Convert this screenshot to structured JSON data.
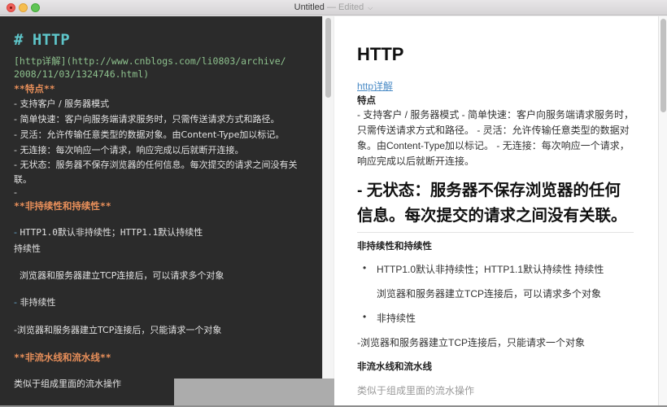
{
  "window": {
    "title": "Untitled",
    "status": "— Edited",
    "title_menu_icon": "chevron-down-icon"
  },
  "traffic_lights": {
    "close": "close-button",
    "minimize": "minimize-button",
    "zoom": "zoom-button"
  },
  "colors": {
    "editor_bg": "#2b2b2b",
    "heading": "#5ec5c9",
    "link": "#8dc08d",
    "bold": "#e88f5a",
    "list_marker": "#6aaed6",
    "preview_link": "#4a8bc6"
  },
  "editor": {
    "lines": [
      "# HTTP",
      "[http详解](http://www.cnblogs.com/li0803/archive/",
      "2008/11/03/1324746.html)",
      "**特点**",
      "- 支持客户 / 服务器模式",
      "- 简单快速：客户向服务端请求服务时，只需传送请求方式和路径。",
      "- 灵活：允许传输任意类型的数据对象。由Content-Type加以标记。",
      "- 无连接：每次响应一个请求，响应完成以后就断开连接。",
      "- 无状态：服务器不保存浏览器的任何信息。每次提交的请求之间没有关",
      "联。",
      "-",
      "**非持续性和持续性**",
      "- HTTP1.0默认非持续性；HTTP1.1默认持续性",
      "持续性",
      "浏览器和服务器建立TCP连接后，可以请求多个对象",
      "- 非持续性",
      "-浏览器和服务器建立TCP连接后，只能请求一个对象",
      "**非流水线和流水线**",
      "类似于组成里面的流水操作"
    ]
  },
  "preview": {
    "h1": "HTTP",
    "link": "http详解",
    "features_heading": "特点",
    "features_paragraph": "- 支持客户 / 服务器模式 - 简单快速：客户向服务端请求服务时，只需传送请求方式和路径。 - 灵活：允许传输任意类型的数据对象。由Content-Type加以标记。 - 无连接：每次响应一个请求，响应完成以后就断开连接。",
    "h2": "- 无状态：服务器不保存浏览器的任何信息。每次提交的请求之间没有关联。",
    "persistence_heading": "非持续性和持续性",
    "list_item_1": "HTTP1.0默认非持续性；HTTP1.1默认持续性 持续性",
    "list_item_1_sub": "浏览器和服务器建立TCP连接后，可以请求多个对象",
    "list_item_2": "非持续性",
    "non_persistent_paragraph": "-浏览器和服务器建立TCP连接后，只能请求一个对象",
    "pipeline_heading": "非流水线和流水线",
    "pipeline_paragraph": "类似于组成里面的流水操作"
  }
}
